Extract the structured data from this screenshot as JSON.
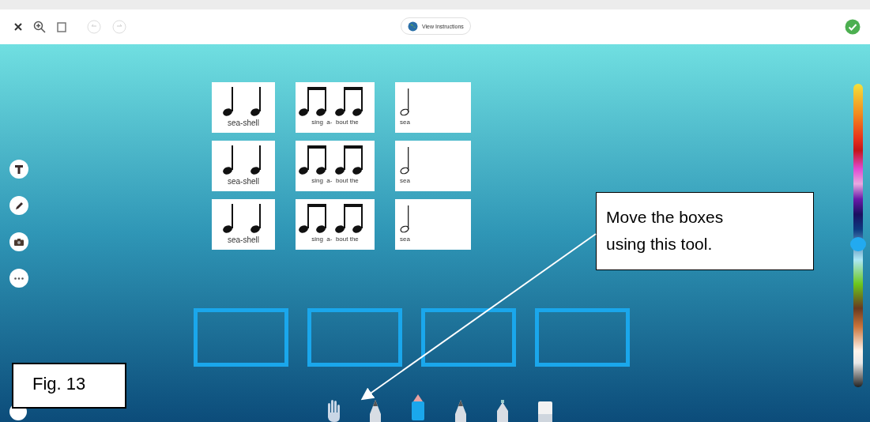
{
  "toolbar": {
    "view_instructions": "View Instructions",
    "completed": true
  },
  "cards": [
    {
      "kind": "crotchets",
      "label": "sea-shell"
    },
    {
      "kind": "quavers",
      "label": "sing  a-  bout the"
    },
    {
      "kind": "minim",
      "label": "sea"
    },
    {
      "kind": "crotchets",
      "label": "sea-shell"
    },
    {
      "kind": "quavers",
      "label": "sing  a-  bout the"
    },
    {
      "kind": "minim",
      "label": "sea"
    },
    {
      "kind": "crotchets",
      "label": "sea-shell"
    },
    {
      "kind": "quavers",
      "label": "sing  a-  bout the"
    },
    {
      "kind": "minim",
      "label": "sea"
    }
  ],
  "drop_boxes": [
    {
      "kind": "drop-box"
    },
    {
      "kind": "drop-box"
    },
    {
      "kind": "drop-box"
    },
    {
      "kind": "drop-box"
    }
  ],
  "side_tools": [
    {
      "kind": "text"
    },
    {
      "kind": "pencil"
    },
    {
      "kind": "camera"
    },
    {
      "kind": "more"
    }
  ],
  "drawing_tools": [
    {
      "kind": "hand",
      "selected": false
    },
    {
      "kind": "pen",
      "selected": false
    },
    {
      "kind": "marker",
      "selected": true
    },
    {
      "kind": "pen",
      "selected": false
    },
    {
      "kind": "spray",
      "selected": false
    },
    {
      "kind": "eraser",
      "selected": false
    }
  ],
  "callout": {
    "text": "Move the boxes using this tool."
  },
  "figure_label": "Fig. 13"
}
